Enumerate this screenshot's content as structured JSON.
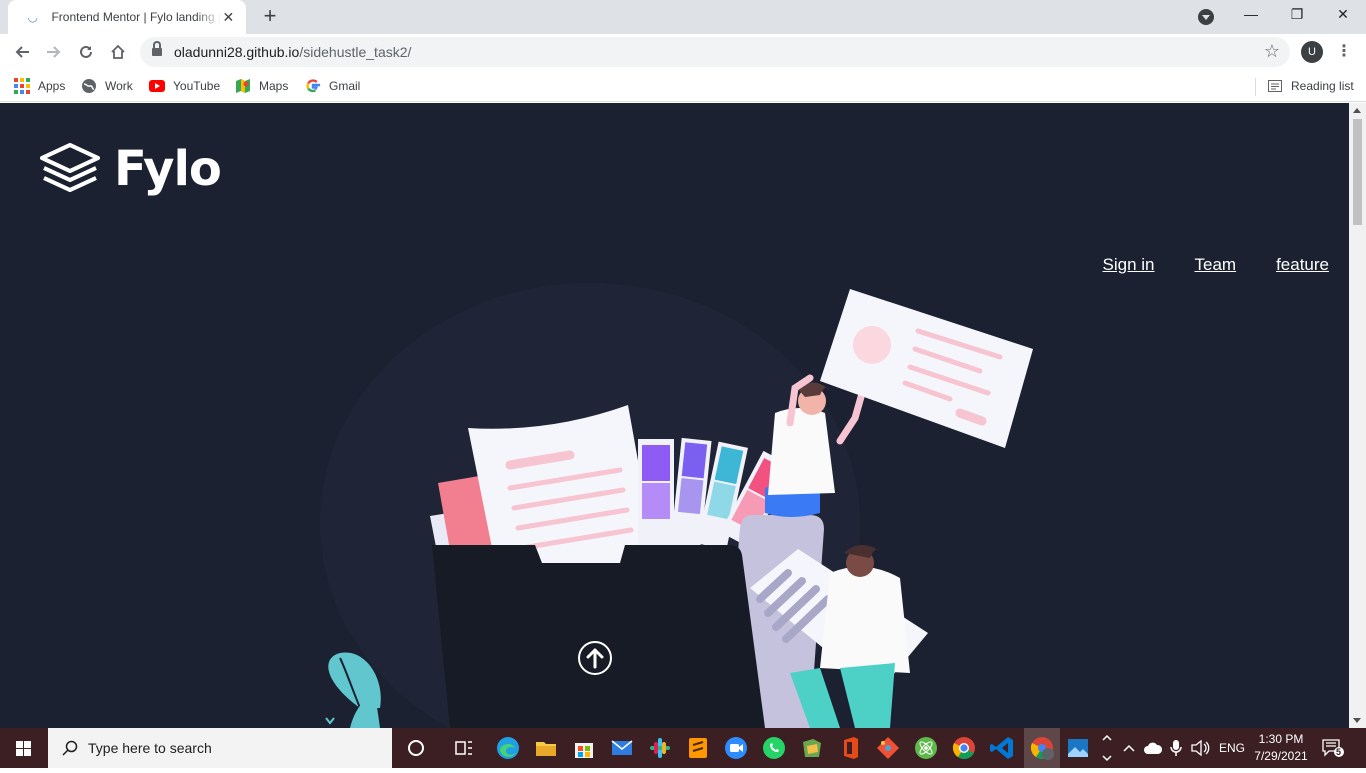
{
  "browser": {
    "tab_title": "Frontend Mentor | Fylo landing page",
    "tab_close": "✕",
    "new_tab": "+",
    "url_host": "oladunni28.github.io",
    "url_path": "/sidehustle_task2/",
    "profile_initial": "U",
    "window_controls": {
      "minimize": "—",
      "restore": "❐",
      "close": "✕"
    }
  },
  "bookmarks": [
    {
      "label": "Apps",
      "icon": "apps-grid-icon"
    },
    {
      "label": "Work",
      "icon": "globe-icon"
    },
    {
      "label": "YouTube",
      "icon": "youtube-icon"
    },
    {
      "label": "Maps",
      "icon": "maps-icon"
    },
    {
      "label": "Gmail",
      "icon": "google-icon"
    }
  ],
  "reading_list": "Reading list",
  "page": {
    "brand": "Fylo",
    "nav": [
      "Sign in",
      "Team",
      "feature"
    ],
    "background": "#1b2130",
    "accent": "#f7c4d1"
  },
  "taskbar": {
    "search_placeholder": "Type here to search",
    "language": "ENG",
    "time": "1:30 PM",
    "date": "7/29/2021",
    "notification_count": "5",
    "color": "#3b1f22"
  }
}
